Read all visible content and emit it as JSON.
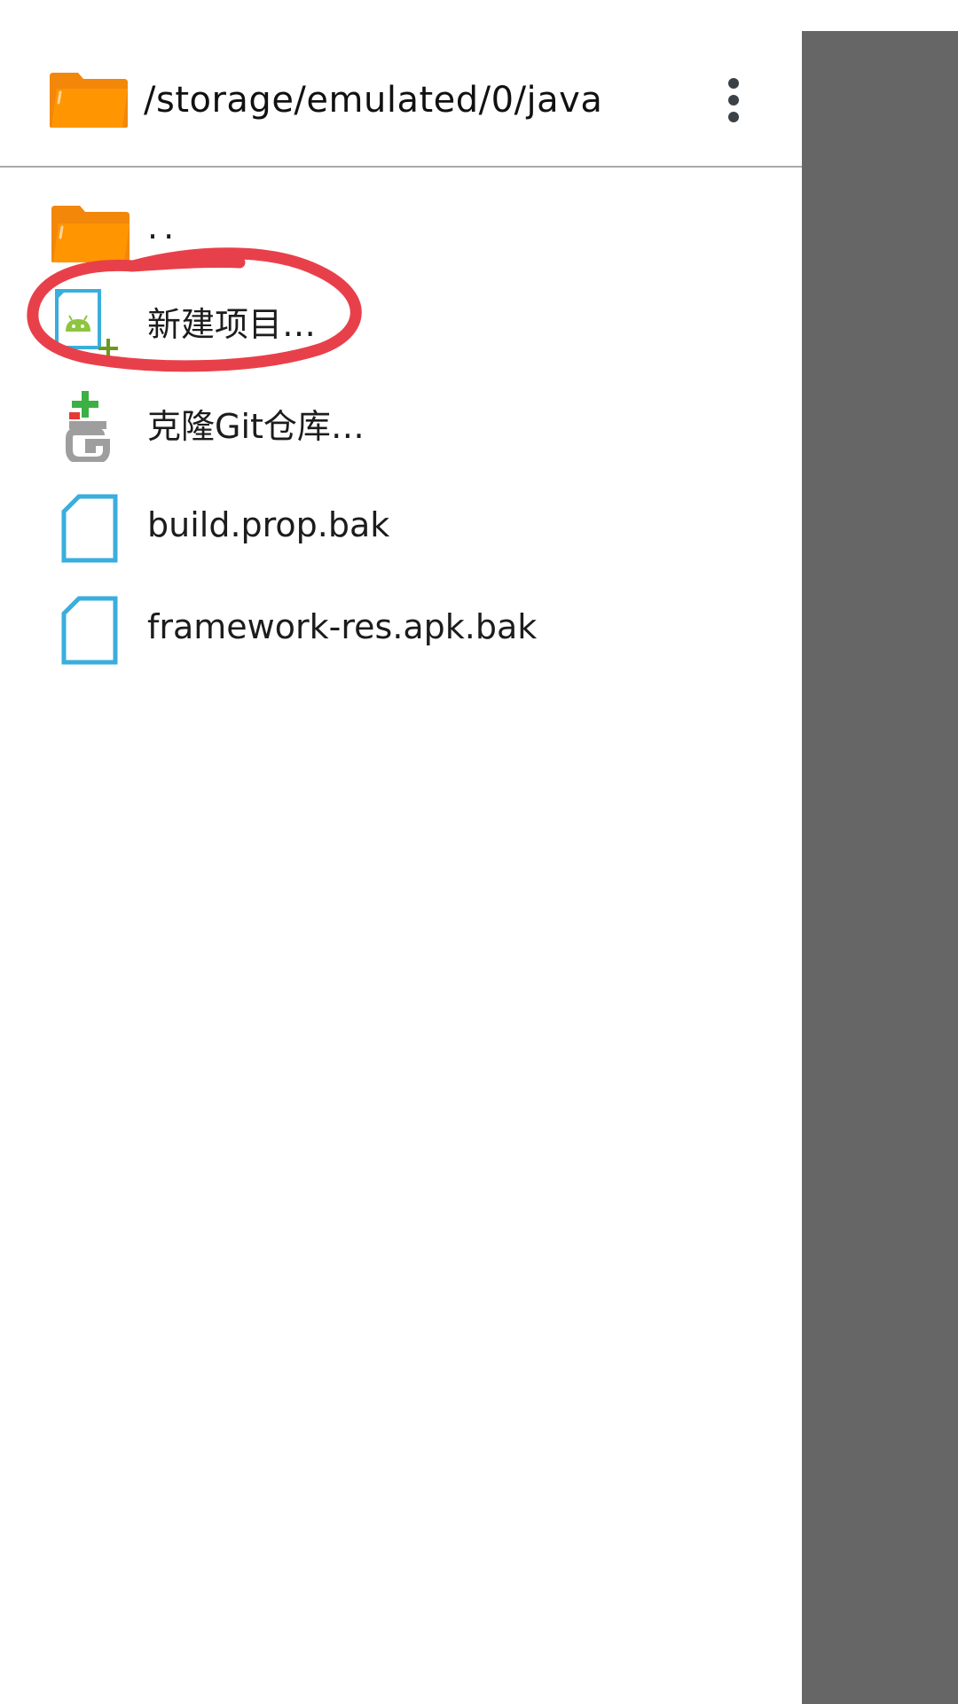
{
  "header": {
    "path": "/storage/emulated/0/java",
    "folder_icon": "folder-icon",
    "menu_icon": "more-vert-icon"
  },
  "items": [
    {
      "label": "..",
      "icon": "folder-icon"
    },
    {
      "label": "新建项目…",
      "icon": "new-android-project-icon"
    },
    {
      "label": "克隆Git仓库…",
      "icon": "git-clone-icon"
    },
    {
      "label": "build.prop.bak",
      "icon": "file-icon"
    },
    {
      "label": "framework-res.apk.bak",
      "icon": "file-icon"
    }
  ],
  "colors": {
    "folder": "#FF8C00",
    "file_outline": "#3AAEDC",
    "android_green": "#8DC540",
    "git_green": "#3CB043",
    "git_red": "#E53935",
    "annotation_red": "#E8404A",
    "scrim": "#666666"
  }
}
